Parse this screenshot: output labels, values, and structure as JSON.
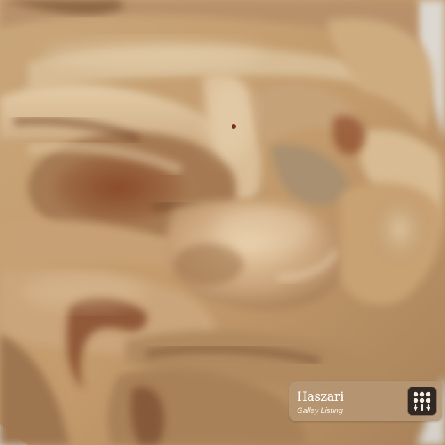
{
  "image": {
    "subject": "close-up of a carved stone grotesque face",
    "palette": {
      "stone_light": "#dcc3a0",
      "stone_mid": "#c39a6b",
      "stone_dark": "#7f5a3a",
      "rust": "#8f4a28",
      "backdrop": "#d9d6cf"
    }
  },
  "tag": {
    "title": "Haszari",
    "subtitle": "Galley Listing",
    "background": "#b69674",
    "logo_icon": "dice-grid-icon"
  }
}
